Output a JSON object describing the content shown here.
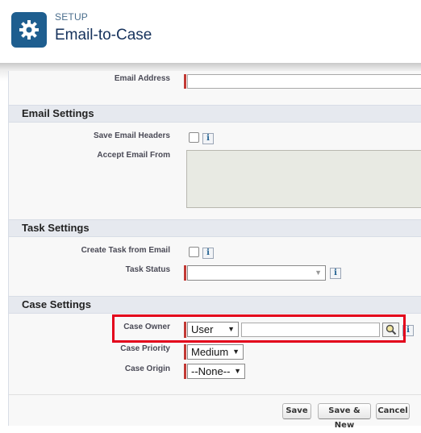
{
  "header": {
    "subtitle": "SETUP",
    "title": "Email-to-Case"
  },
  "fields": {
    "email_address_label": "Email Address",
    "save_headers_label": "Save Email Headers",
    "accept_from_label": "Accept Email From",
    "create_task_label": "Create Task from Email",
    "task_status_label": "Task Status",
    "case_owner_label": "Case Owner",
    "case_priority_label": "Case Priority",
    "case_origin_label": "Case Origin"
  },
  "sections": {
    "email_settings": "Email Settings",
    "task_settings": "Task Settings",
    "case_settings": "Case Settings"
  },
  "values": {
    "case_owner_type": "User",
    "case_priority": "Medium",
    "case_origin": "--None--",
    "task_status": ""
  },
  "info_glyph": "i",
  "buttons": {
    "save": "Save",
    "save_new": "Save & New",
    "cancel": "Cancel"
  },
  "colors": {
    "brand_icon": "#1e5e8f",
    "required": "#c23934",
    "highlight": "#e3001b"
  },
  "icons": {
    "header": "gear-icon",
    "lookup": "magnifier-icon"
  }
}
